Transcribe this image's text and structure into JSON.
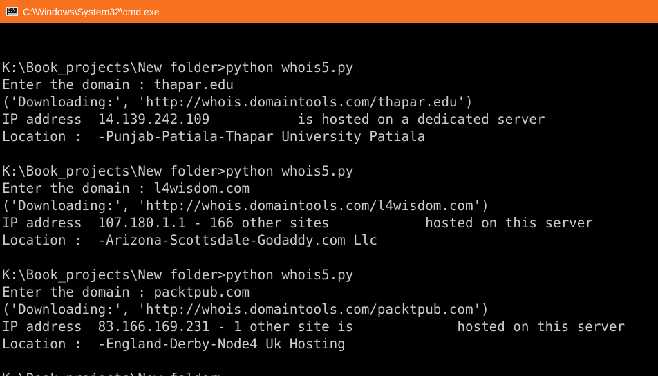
{
  "window": {
    "title": "C:\\Windows\\System32\\cmd.exe",
    "icon": "cmd-icon",
    "icon_text": "C:\\.",
    "titlebar_color": "#f7711e",
    "console_bg": "#000000",
    "console_fg": "#cccccc"
  },
  "console": {
    "lines": [
      "",
      "K:\\Book_projects\\New folder>python whois5.py",
      "Enter the domain : thapar.edu",
      "('Downloading:', 'http://whois.domaintools.com/thapar.edu')",
      "IP address  14.139.242.109           is hosted on a dedicated server",
      "Location :  -Punjab-Patiala-Thapar University Patiala",
      "",
      "K:\\Book_projects\\New folder>python whois5.py",
      "Enter the domain : l4wisdom.com",
      "('Downloading:', 'http://whois.domaintools.com/l4wisdom.com')",
      "IP address  107.180.1.1 - 166 other sites            hosted on this server",
      "Location :  -Arizona-Scottsdale-Godaddy.com Llc",
      "",
      "K:\\Book_projects\\New folder>python whois5.py",
      "Enter the domain : packtpub.com",
      "('Downloading:', 'http://whois.domaintools.com/packtpub.com')",
      "IP address  83.166.169.231 - 1 other site is             hosted on this server",
      "Location :  -England-Derby-Node4 Uk Hosting",
      "",
      "K:\\Book_projects\\New folder>"
    ]
  }
}
